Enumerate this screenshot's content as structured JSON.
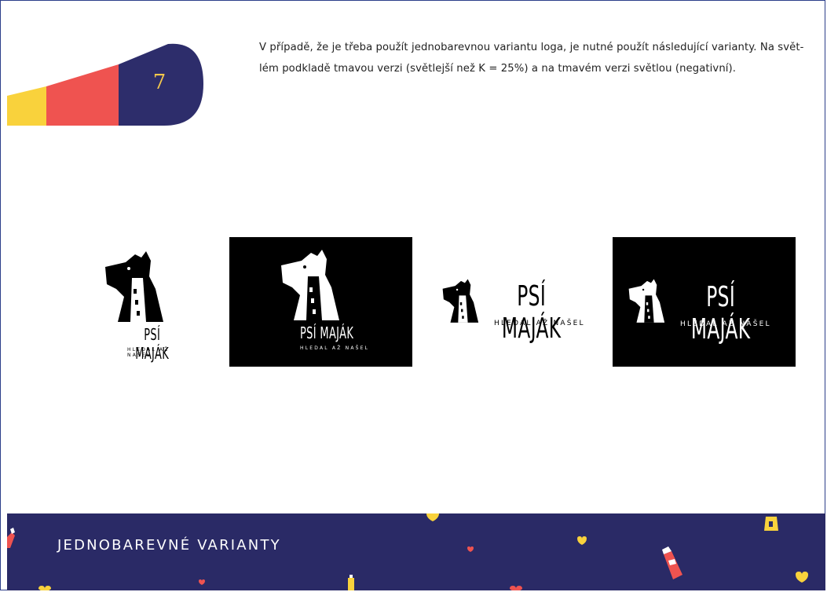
{
  "page": {
    "number": "7",
    "intro_line1": "V případě, že je třeba použít jednobarevnou variantu loga, je nutné použít následující varianty. Na svět-",
    "intro_line2": "lém podkladě tmavou verzi (světlejší než K = 25%) a na tmavém verzi světlou (negativní)."
  },
  "logo": {
    "name": "PSÍ MAJÁK",
    "tagline": "HLEDAL AŽ NAŠEL"
  },
  "footer": {
    "title": "JEDNOBAREVNÉ VARIANTY"
  },
  "colors": {
    "navy": "#2d2d6b",
    "red": "#ef5350",
    "yellow": "#f9d23c",
    "black": "#000000",
    "white": "#ffffff"
  }
}
